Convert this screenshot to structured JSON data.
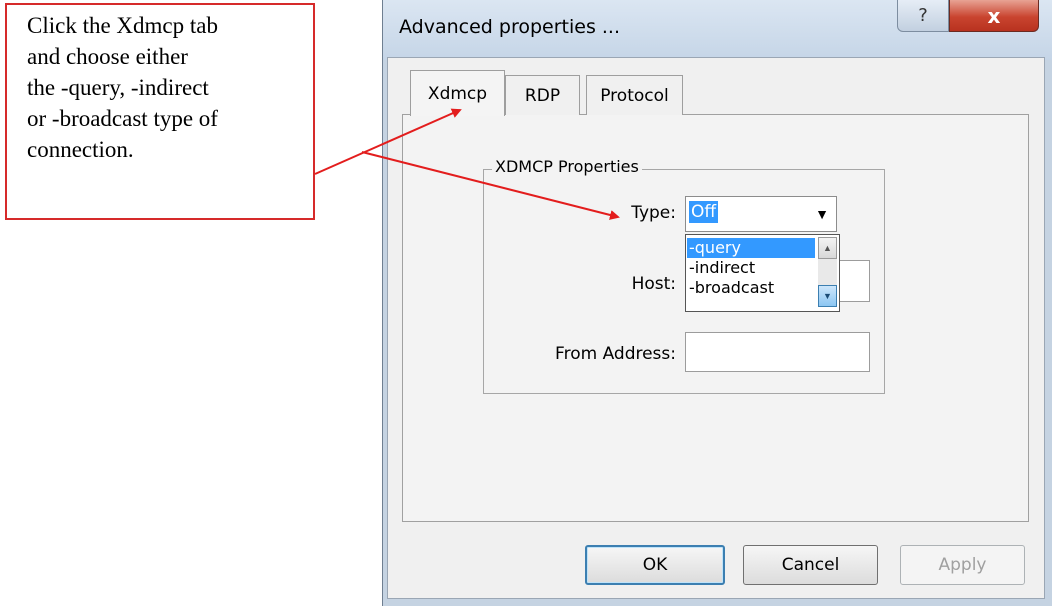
{
  "annotation": {
    "text": "Click the Xdmcp tab\nand choose either\nthe -query, -indirect\nor -broadcast type of\nconnection.",
    "color": "#d62a2a"
  },
  "window": {
    "title": "Advanced properties ...",
    "help_icon": "?",
    "close_icon": "x"
  },
  "tabs": [
    {
      "label": "Xdmcp",
      "active": true
    },
    {
      "label": "RDP",
      "active": false
    },
    {
      "label": "Protocol",
      "active": false
    }
  ],
  "group": {
    "title": "XDMCP Properties",
    "type_label": "Type:",
    "type_value": "Off",
    "host_label": "Host:",
    "host_value": "",
    "from_label": "From Address:",
    "from_value": ""
  },
  "dropdown": {
    "options": [
      "-query",
      "-indirect",
      "-broadcast"
    ],
    "selected": "-query"
  },
  "buttons": {
    "ok": "OK",
    "cancel": "Cancel",
    "apply": "Apply"
  },
  "colors": {
    "selection": "#3399ff",
    "arrow": "#e31d1d"
  }
}
